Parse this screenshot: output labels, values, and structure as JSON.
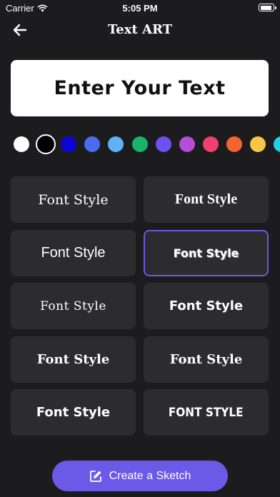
{
  "status_bar": {
    "carrier": "Carrier",
    "time": "5:05 PM"
  },
  "nav": {
    "title": "Text ART",
    "back_icon": "arrow-left-icon"
  },
  "preview": {
    "text": "Enter Your Text"
  },
  "colors": [
    {
      "name": "white",
      "hex": "#ffffff",
      "selected": false
    },
    {
      "name": "black",
      "hex": "#000000",
      "selected": true
    },
    {
      "name": "navy-blue",
      "hex": "#0a06d8",
      "selected": false
    },
    {
      "name": "royal-blue",
      "hex": "#4a6cf0",
      "selected": false
    },
    {
      "name": "sky-blue",
      "hex": "#5fb0f5",
      "selected": false
    },
    {
      "name": "green",
      "hex": "#18b46a",
      "selected": false
    },
    {
      "name": "violet",
      "hex": "#6e4ff0",
      "selected": false
    },
    {
      "name": "magenta",
      "hex": "#b34ed8",
      "selected": false
    },
    {
      "name": "pink",
      "hex": "#f0406e",
      "selected": false
    },
    {
      "name": "orange",
      "hex": "#f2652e",
      "selected": false
    },
    {
      "name": "yellow",
      "hex": "#f7c548",
      "selected": false
    },
    {
      "name": "cyan",
      "hex": "#20d0e8",
      "selected": false
    }
  ],
  "fonts": [
    {
      "label": "Font Style",
      "selected": false
    },
    {
      "label": "Font Style",
      "selected": false
    },
    {
      "label": "Font Style",
      "selected": false
    },
    {
      "label": "Font Style",
      "selected": true
    },
    {
      "label": "Font Style",
      "selected": false
    },
    {
      "label": "Font Style",
      "selected": false
    },
    {
      "label": "Font Style",
      "selected": false
    },
    {
      "label": "Font Style",
      "selected": false
    },
    {
      "label": "Font Style",
      "selected": false
    },
    {
      "label": "FONT STYLE",
      "selected": false
    }
  ],
  "cta": {
    "label": "Create a Sketch",
    "icon": "edit-icon"
  },
  "accent": "#6b59e8",
  "background": "#1c1c1e",
  "tile_background": "#2c2c2e"
}
